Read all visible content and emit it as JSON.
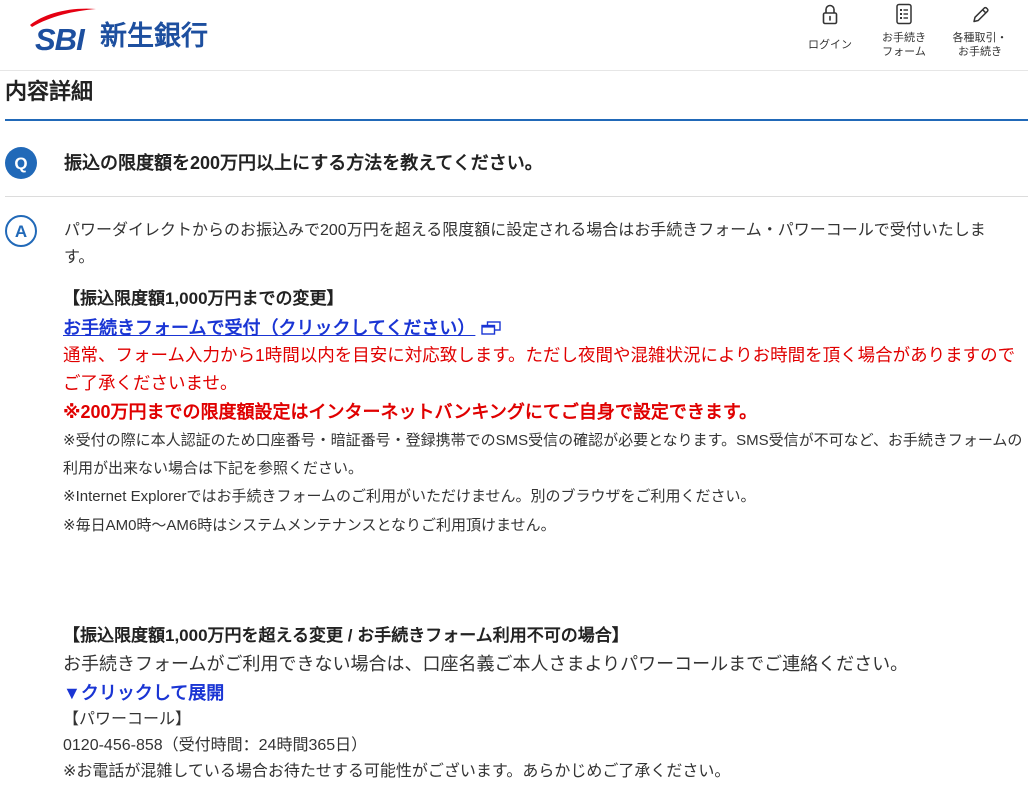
{
  "header": {
    "logo": {
      "mark": "SBI",
      "name": "新生銀行"
    },
    "nav": [
      {
        "icon": "lock-icon",
        "label_line1": "ログイン"
      },
      {
        "icon": "form-icon",
        "label_line1": "お手続き",
        "label_line2": "フォーム"
      },
      {
        "icon": "pen-icon",
        "label_line1": "各種取引・",
        "label_line2": "お手続き"
      }
    ]
  },
  "page_title": "内容詳細",
  "question": {
    "marker": "Q",
    "text": "振込の限度額を200万円以上にする方法を教えてください。"
  },
  "answer": {
    "marker": "A",
    "intro": "パワーダイレクトからのお振込みで200万円を超える限度額に設定される場合はお手続きフォーム・パワーコールで受付いたします。",
    "section1": {
      "heading": "【振込限度額1,000万円までの変更】",
      "link_label": "お手続きフォームで受付（クリックしてください）",
      "link_icon": "external-window-icon",
      "notice": "通常、フォーム入力から1時間以内を目安に対応致します。ただし夜間や混雑状況によりお時間を頂く場合がありますのでご了承くださいませ。",
      "emphasis": "※200万円までの限度額設定はインターネットバンキングにてご自身で設定できます。",
      "notes": [
        "※受付の際に本人認証のため口座番号・暗証番号・登録携帯でのSMS受信の確認が必要となります。SMS受信が不可など、お手続きフォームの利用が出来ない場合は下記を参照ください。",
        "※Internet Explorerではお手続きフォームのご利用がいただけません。別のブラウザをご利用ください。",
        "※毎日AM0時～AM6時はシステムメンテナンスとなりご利用頂けません。"
      ]
    },
    "section2": {
      "heading": "【振込限度額1,000万円を超える変更 / お手続きフォーム利用不可の場合】",
      "text": "お手続きフォームがご利用できない場合は、口座名義ご本人さまよりパワーコールまでご連絡ください。",
      "expand_label": "▼クリックして展開",
      "contact_title": "【パワーコール】",
      "contact_phone": "0120-456-858（受付時間：24時間365日）",
      "contact_note": "※お電話が混雑している場合お待たせする可能性がございます。あらかじめご了承ください。"
    }
  },
  "colors": {
    "brand_blue": "#2169b8",
    "logo_blue": "#1d4f9f",
    "logo_red": "#e50012",
    "link_blue": "#1a35d4",
    "alert_red": "#e00000",
    "text": "#333333"
  }
}
